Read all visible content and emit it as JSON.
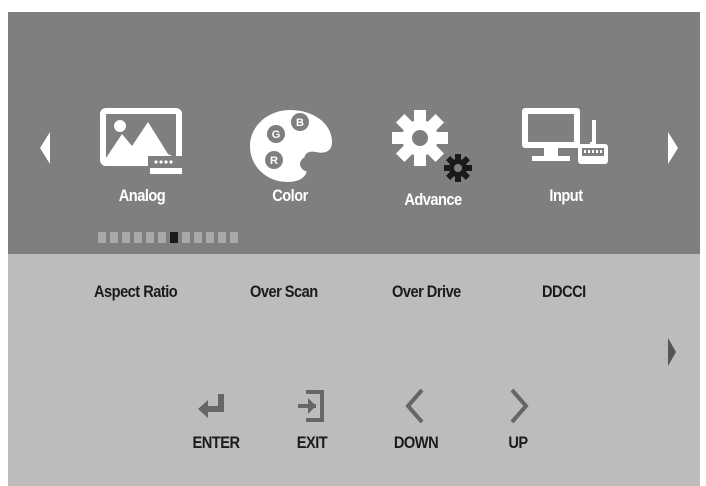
{
  "colors": {
    "top_panel": "#7f7f7f",
    "bottom_panel": "#bcbcbc",
    "icon": "#ffffff",
    "text_dark": "#1b1b1b",
    "dot_inactive": "#a9a9a9",
    "dot_active": "#1a1a1a"
  },
  "top_menu": {
    "prev_icon": "chevron-left-icon",
    "next_icon": "chevron-right-icon",
    "items": [
      {
        "label": "Analog",
        "icon": "analog-image-icon"
      },
      {
        "label": "Color",
        "icon": "color-palette-icon"
      },
      {
        "label": "Advance",
        "icon": "gears-icon"
      },
      {
        "label": "Input",
        "icon": "computer-input-icon"
      }
    ],
    "page_indicator": {
      "total": 12,
      "active_index": 6
    }
  },
  "submenu": {
    "items": [
      {
        "label": "Aspect Ratio"
      },
      {
        "label": "Over Scan"
      },
      {
        "label": "Over Drive"
      },
      {
        "label": "DDCCI"
      }
    ],
    "next_icon": "chevron-right-icon"
  },
  "keys": [
    {
      "label": "ENTER",
      "icon": "enter-icon"
    },
    {
      "label": "EXIT",
      "icon": "exit-icon"
    },
    {
      "label": "DOWN",
      "icon": "chevron-left-icon"
    },
    {
      "label": "UP",
      "icon": "chevron-right-icon"
    }
  ]
}
